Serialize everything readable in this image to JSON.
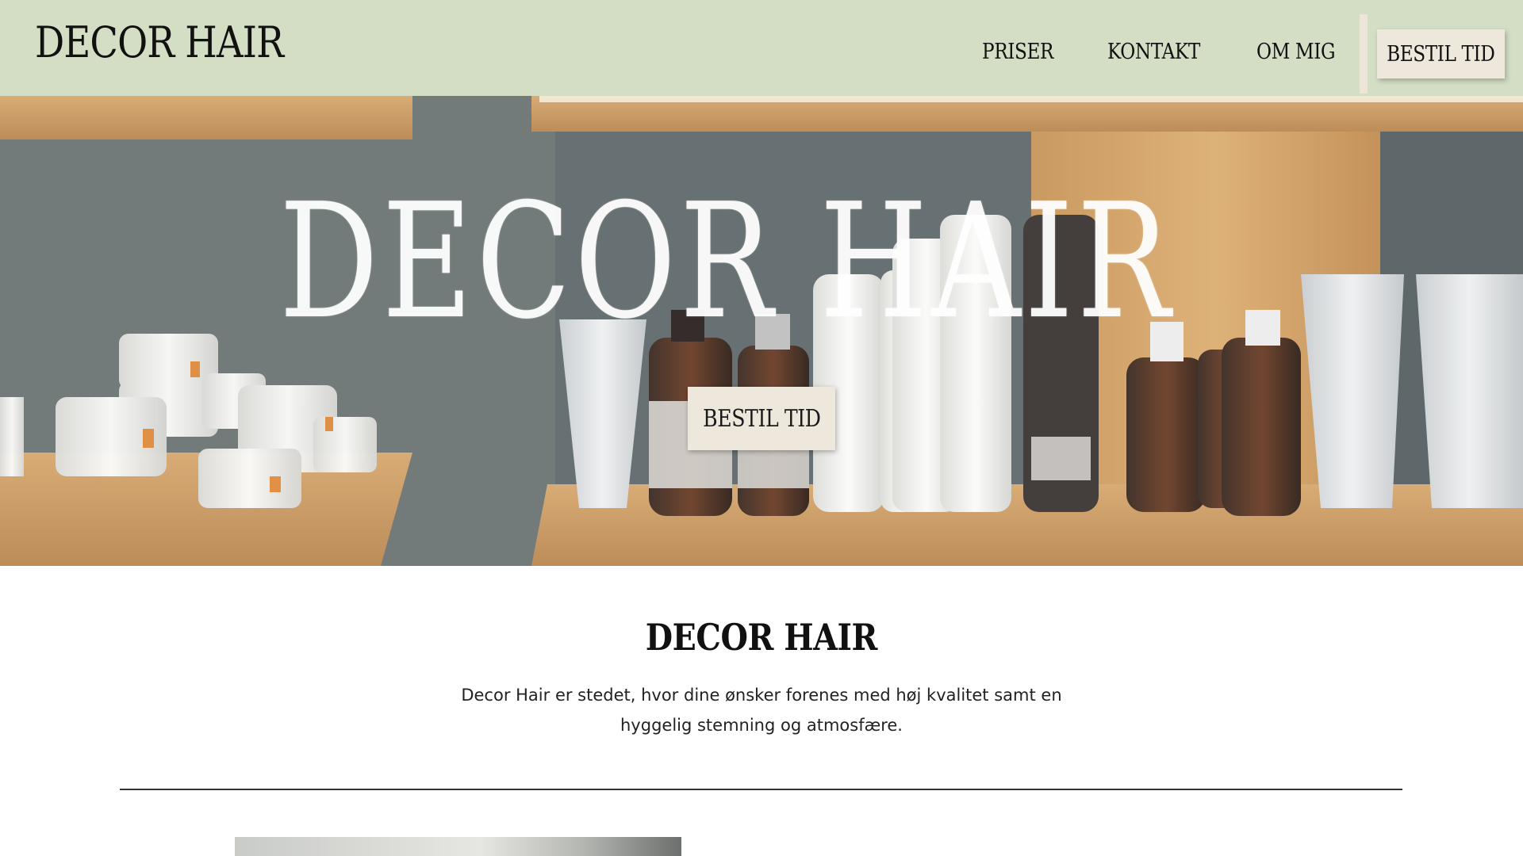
{
  "header": {
    "logo": "DECOR HAIR",
    "nav": [
      {
        "label": "PRISER"
      },
      {
        "label": "KONTAKT"
      },
      {
        "label": "OM MIG"
      }
    ],
    "cta_label": "BESTIL TID",
    "background_color": "#d4dec4"
  },
  "hero": {
    "title": "DECOR HAIR",
    "cta_label": "BESTIL TID",
    "image_description_icon": "product-shelf-photo"
  },
  "intro": {
    "title": "DECOR HAIR",
    "text": "Decor Hair er stedet, hvor dine ønsker forenes med høj kvalitet samt en hyggelig stemning og atmosfære."
  },
  "colors": {
    "button_bg": "#ede7dc",
    "text": "#111111"
  }
}
